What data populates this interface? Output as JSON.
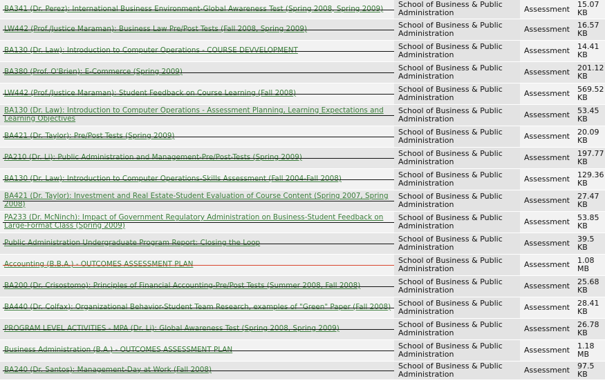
{
  "rows": [
    {
      "title": "BA341 (Dr. Perez): International Business Environment-Global Awareness Test (Spring 2008, Spring 2009)",
      "school": "School of Business & Public Administration",
      "type": "Assessment",
      "size": "15.07 KB",
      "strike_color": "#111111"
    },
    {
      "title": "LW442 (Prof./Justice Maraman): Business Law Pre/Post Tests (Fall 2008, Spring 2009)",
      "school": "School of Business & Public Administration",
      "type": "Assessment",
      "size": "16.57 KB",
      "strike_color": "#111111"
    },
    {
      "title": "BA130 (Dr. Law): Introduction to Computer Operations - COURSE DEVVELOPMENT",
      "school": "School of Business & Public Administration",
      "type": "Assessment",
      "size": "14.41 KB",
      "strike_color": "#111111"
    },
    {
      "title": "BA380 (Prof. O'Brien): E-Commerce (Spring 2009)",
      "school": "School of Business & Public Administration",
      "type": "Assessment",
      "size": "201.12 KB",
      "strike_color": "#111111"
    },
    {
      "title": "LW442 (Prof./Justice Maraman): Student Feedback on Course Learning (Fall 2008)",
      "school": "School of Business & Public Administration",
      "type": "Assessment",
      "size": "569.52 KB",
      "strike_color": "#111111"
    },
    {
      "title": "BA130 (Dr. Law): Introduction to Computer Operations - Assessment Planning, Learning Expectations and Learning Objectives",
      "school": "School of Business & Public Administration",
      "type": "Assessment",
      "size": "53.45 KB",
      "strike_color": "#111111"
    },
    {
      "title": "BA421 (Dr. Taylor): Pre/Post Tests (Spring 2009)",
      "school": "School of Business & Public Administration",
      "type": "Assessment",
      "size": "20.09 KB",
      "strike_color": "#111111"
    },
    {
      "title": "PA210 (Dr. Li): Public Administration and Management-Pre/Post-Tests (Spring 2009)",
      "school": "School of Business & Public Administration",
      "type": "Assessment",
      "size": "197.77 KB",
      "strike_color": "#111111"
    },
    {
      "title": "BA130 (Dr. Law): Introduction to Computer Operations-Skills Assessment (Fall 2004-Fall 2008)",
      "school": "School of Business & Public Administration",
      "type": "Assessment",
      "size": "129.36 KB",
      "strike_color": "#111111"
    },
    {
      "title": "BA421 (Dr. Taylor): Investment and Real Estate-Student Evaluation of Course Content (Spring 2007, Spring 2008)",
      "school": "School of Business & Public Administration",
      "type": "Assessment",
      "size": "27.47 KB",
      "strike_color": "#111111"
    },
    {
      "title": "PA233 (Dr. McNinch): Impact of Government Regulatory Administration on Business-Student Feedback on Large-Format Class (Spring 2009)",
      "school": "School of Business & Public Administration",
      "type": "Assessment",
      "size": "53.85 KB",
      "strike_color": "#111111"
    },
    {
      "title": "Public Administration Undergraduate Program Report: Closing the Loop",
      "school": "School of Business & Public Administration",
      "type": "Assessment",
      "size": "39.5 KB",
      "strike_color": "#111111"
    },
    {
      "title": "Accounting (B.B.A.) - OUTCOMES ASSESSMENT PLAN",
      "school": "School of Business & Public Administration",
      "type": "Assessment",
      "size": "1.08 MB",
      "strike_color": "#d8442c"
    },
    {
      "title": "BA200 (Dr. Crisostomo): Principles of Financial Accounting-Pre/Post Tests (Summer 2008, Fall 2008)",
      "school": "School of Business & Public Administration",
      "type": "Assessment",
      "size": "25.68 KB",
      "strike_color": "#111111"
    },
    {
      "title": "BA440 (Dr. Colfax): Organizational Behavior-Student Team Research, examples of \"Green\" Paper (Fall 2008)",
      "school": "School of Business & Public Administration",
      "type": "Assessment",
      "size": "28.41 KB",
      "strike_color": "#111111"
    },
    {
      "title": "PROGRAM LEVEL ACTIVITIES - MPA (Dr. Li): Global Awareness Test (Spring 2008, Spring 2009)",
      "school": "School of Business & Public Administration",
      "type": "Assessment",
      "size": "26.78 KB",
      "strike_color": "#111111"
    },
    {
      "title": "Business Administration (B.A.) - OUTCOMES ASSESSMENT PLAN",
      "school": "School of Business & Public Administration",
      "type": "Assessment",
      "size": "1.18 MB",
      "strike_color": "#111111"
    },
    {
      "title": "BA240 (Dr. Santos): Management-Day at Work (Fall 2008)",
      "school": "School of Business & Public Administration",
      "type": "Assessment",
      "size": "97.5 KB",
      "strike_color": "#111111"
    }
  ]
}
